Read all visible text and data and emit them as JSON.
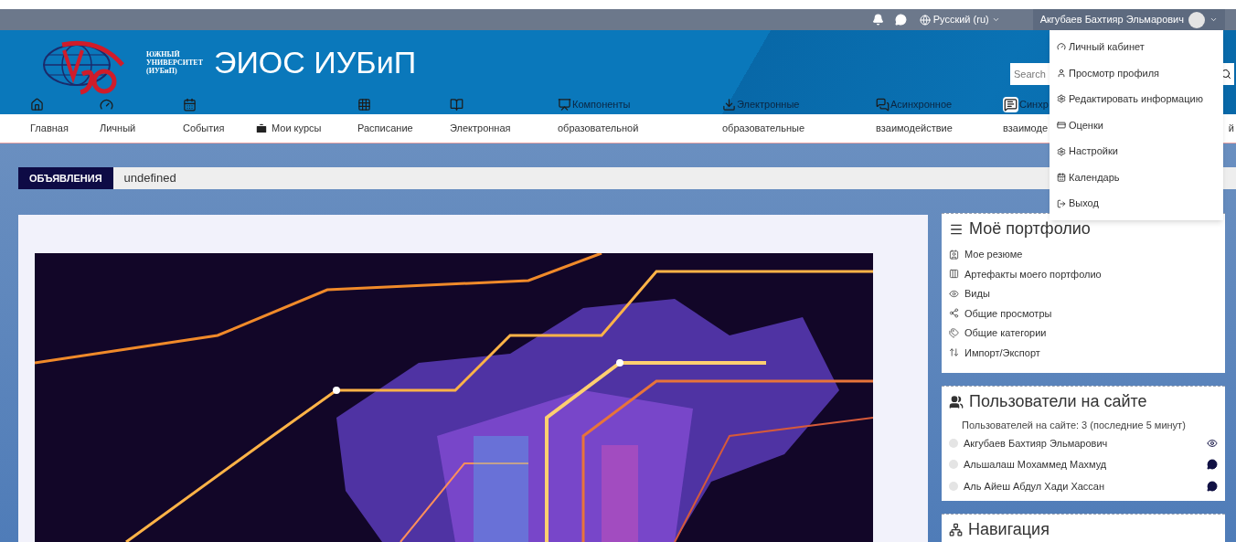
{
  "top_bar": {
    "language": "Русский (ru)",
    "user": "Акгубаев Бахтияр Эльмарович"
  },
  "header": {
    "logo_lines": [
      "ЮЖНЫЙ",
      "УНИВЕРСИТЕТ",
      "(ИУБиП)"
    ],
    "site_title": "ЭИОС ИУБиП",
    "search": {
      "placeholder": "Search"
    }
  },
  "nav": [
    {
      "label": "Главная"
    },
    {
      "label": "Личный"
    },
    {
      "label": "События"
    },
    {
      "label": "Мои курсы"
    },
    {
      "label": "Расписание"
    },
    {
      "label": "Электронная"
    },
    {
      "top": "Компоненты",
      "label": "образовательной"
    },
    {
      "top": "Электронные",
      "label": "образовательные"
    },
    {
      "top": "Асинхронное",
      "label": "взаимодействие"
    },
    {
      "top": "Синхр",
      "label": "взаимоде"
    },
    {
      "label": "й"
    }
  ],
  "announcements": {
    "badge": "ОБЪЯВЛЕНИЯ",
    "text": "undefined"
  },
  "user_menu": [
    {
      "label": "Личный кабинет"
    },
    {
      "label": "Просмотр профиля"
    },
    {
      "label": "Редактировать информацию"
    },
    {
      "label": "Оценки"
    },
    {
      "label": "Настройки"
    },
    {
      "label": "Календарь"
    },
    {
      "label": "Выход"
    }
  ],
  "portfolio": {
    "title": "Моё портфолио",
    "items": [
      {
        "label": "Мое резюме"
      },
      {
        "label": "Артефакты моего портфолио"
      },
      {
        "label": "Виды"
      },
      {
        "label": "Общие просмотры"
      },
      {
        "label": "Общие категории"
      },
      {
        "label": "Импорт/Экспорт"
      }
    ]
  },
  "online_users": {
    "title": "Пользователи на сайте",
    "summary": "Пользователей на сайте: 3 (последние 5 минут)",
    "users": [
      {
        "name": "Акгубаев Бахтияр Эльмарович",
        "kind": "viewing"
      },
      {
        "name": "Альшалаш Мохаммед Махмуд",
        "kind": "message"
      },
      {
        "name": "Аль Айеш Абдул Хади Хассан",
        "kind": "message"
      }
    ]
  },
  "navigation": {
    "title": "Навигация"
  }
}
